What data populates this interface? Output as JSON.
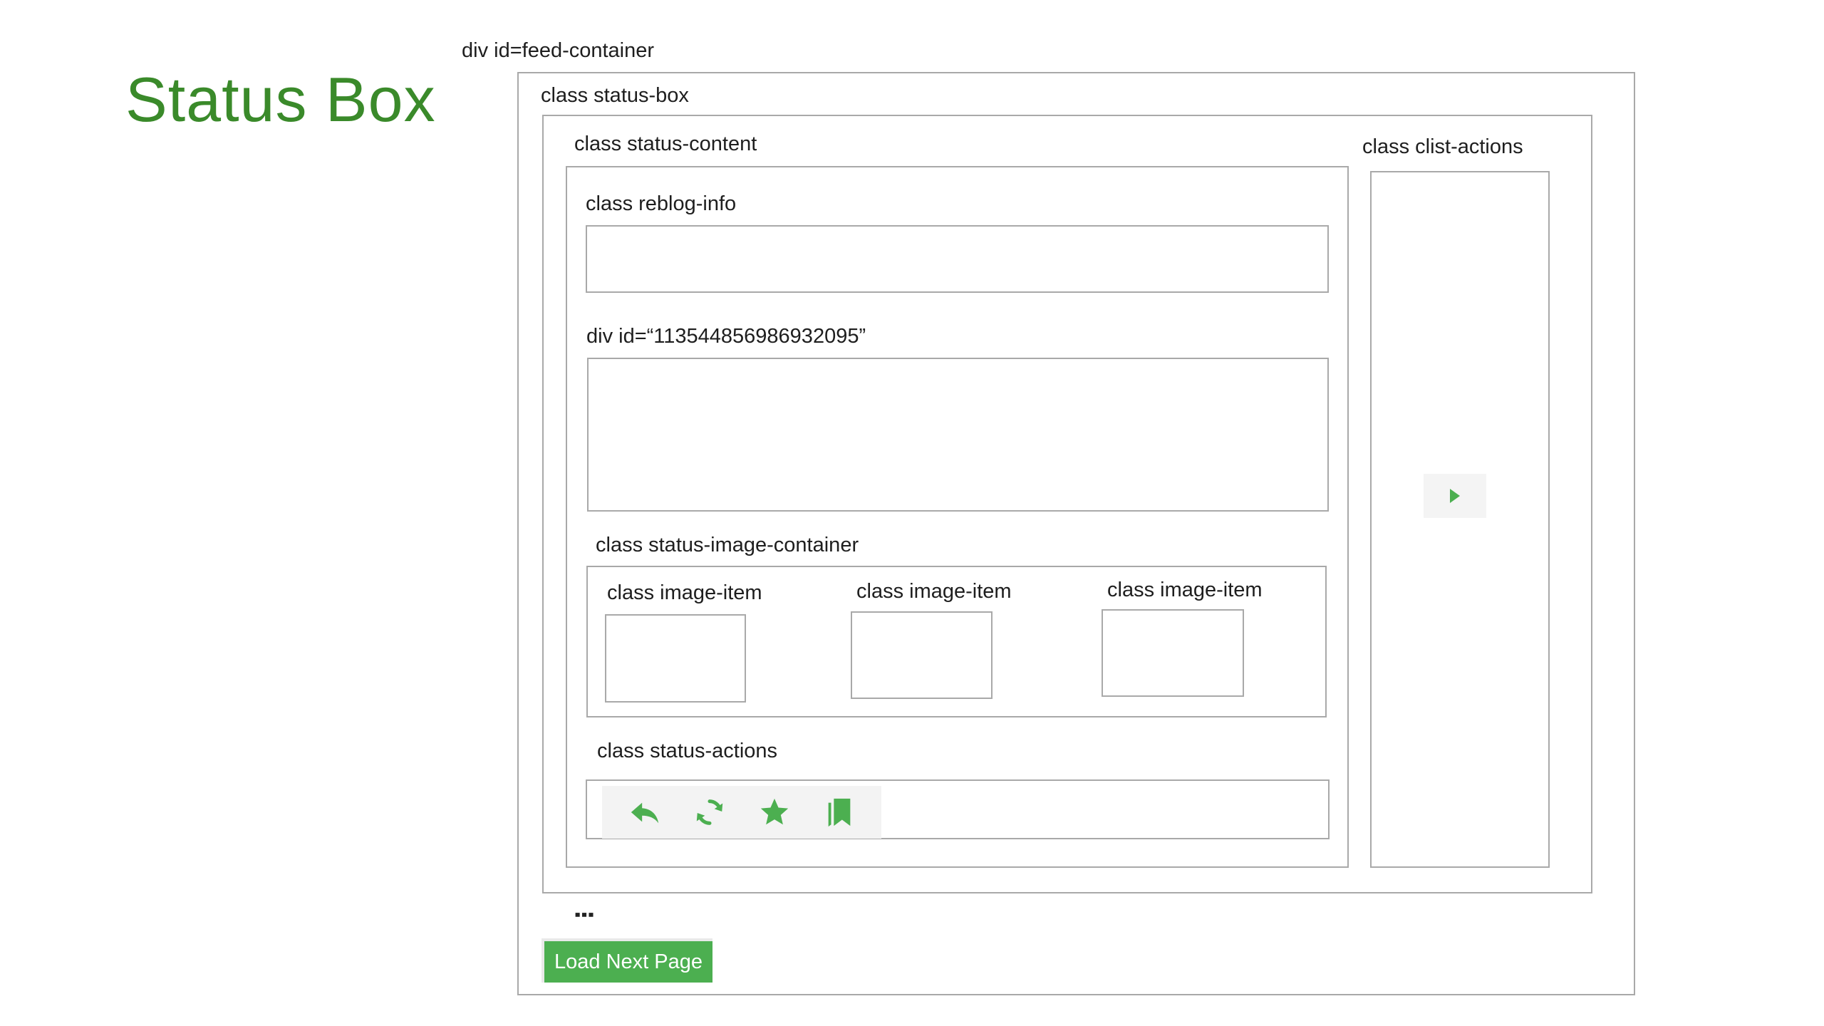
{
  "title": "Status Box",
  "labels": {
    "feed_container": "div id=feed-container",
    "status_box": "class status-box",
    "status_content": "class status-content",
    "clist_actions": "class clist-actions",
    "reblog_info": "class reblog-info",
    "status_div": "div id=“113544856986932095”",
    "image_container": "class status-image-container",
    "image_items": [
      "class image-item",
      "class image-item",
      "class image-item"
    ],
    "status_actions": "class status-actions"
  },
  "status_actions_icons": [
    "reply-icon",
    "reblog-icon",
    "favourite-icon",
    "bookmark-icon"
  ],
  "clist_arrow_icon": "caret-right-icon",
  "ellipsis": "⋮",
  "load_next_label": "Load Next Page",
  "colors": {
    "title_green": "#3a8a2a",
    "icon_green": "#4caf50",
    "button_green": "#4caf50",
    "box_border": "#a9a9a9"
  }
}
